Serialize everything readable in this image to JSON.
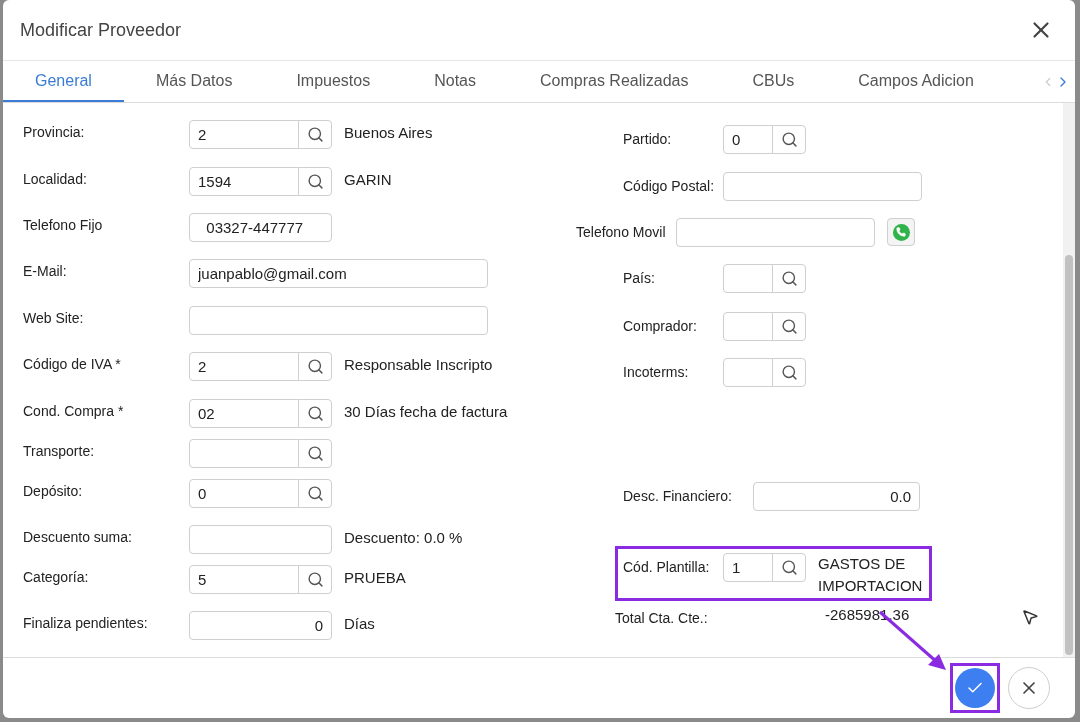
{
  "dialog": {
    "title": "Modificar Proveedor"
  },
  "tabs": [
    {
      "label": "General",
      "selected": true
    },
    {
      "label": "Más Datos",
      "selected": false
    },
    {
      "label": "Impuestos",
      "selected": false
    },
    {
      "label": "Notas",
      "selected": false
    },
    {
      "label": "Compras Realizadas",
      "selected": false
    },
    {
      "label": "CBUs",
      "selected": false
    },
    {
      "label": "Campos Adicion",
      "selected": false
    }
  ],
  "left_fields": [
    {
      "label": "Provincia:",
      "kind": "lookup",
      "value": "2",
      "description": "Buenos Aires"
    },
    {
      "label": "Localidad:",
      "kind": "lookup",
      "value": "1594",
      "description": "GARIN"
    },
    {
      "label": "Telefono Fijo",
      "kind": "short",
      "value": "  03327-447777"
    },
    {
      "label": "E-Mail:",
      "kind": "long",
      "value": "juanpablo@gmail.com"
    },
    {
      "label": "Web Site:",
      "kind": "long"
    },
    {
      "label": "Código de IVA *",
      "kind": "lookup",
      "value": "2",
      "description": "Responsable Inscripto"
    },
    {
      "label": "Cond. Compra *",
      "kind": "lookup",
      "value": "02",
      "description": "30 Días fecha de factura"
    },
    {
      "label": "Transporte:",
      "kind": "lookup"
    },
    {
      "label": "Depósito:",
      "kind": "lookup",
      "value": "0"
    },
    {
      "label": "Descuento suma:",
      "kind": "short",
      "description": "Descuento: 0.0 %"
    },
    {
      "label": "Categoría:",
      "kind": "lookup",
      "value": "5",
      "description": "PRUEBA"
    },
    {
      "label": "Finaliza pendientes:",
      "kind": "number",
      "value": "0",
      "description": "Días"
    }
  ],
  "right_fields": [
    {
      "label": "Partido:",
      "kind": "lookup",
      "value": "0"
    },
    {
      "label": "Código Postal:",
      "kind": "long"
    },
    {
      "label": "Telefono Movil",
      "kind": "phone"
    },
    {
      "label": "País:",
      "kind": "lookup"
    },
    {
      "label": "Comprador:",
      "kind": "lookup"
    },
    {
      "label": "Incoterms:",
      "kind": "lookup"
    },
    {
      "label": "Desc. Financiero:",
      "kind": "number",
      "value": "0.0"
    },
    {
      "label": "Cód. Plantilla:",
      "kind": "lookup",
      "value": "1",
      "description": "GASTOS DE IMPORTACION",
      "highlighted": true
    },
    {
      "label": "Total Cta. Cte.:",
      "kind": "static",
      "value": "-2685981.36"
    }
  ],
  "footer": {
    "confirm_highlighted": true
  }
}
